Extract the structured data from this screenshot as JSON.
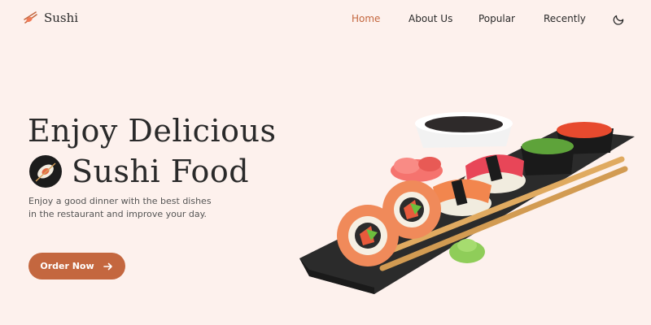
{
  "header": {
    "logo_text": "Sushi",
    "logo_icon": "sushi-chopsticks-icon",
    "nav": [
      {
        "label": "Home",
        "active": true
      },
      {
        "label": "About Us",
        "active": false
      },
      {
        "label": "Popular",
        "active": false
      },
      {
        "label": "Recently",
        "active": false
      }
    ],
    "theme_icon": "moon-icon"
  },
  "hero": {
    "title_line1": "Enjoy Delicious",
    "title_line2": "Sushi Food",
    "description": "Enjoy a good dinner with the best dishes in the restaurant and improve your day.",
    "cta_label": "Order Now",
    "cta_icon": "arrow-right-icon"
  },
  "colors": {
    "background": "#fdf1ed",
    "accent": "#c4673f",
    "text": "#2a2a2a"
  }
}
